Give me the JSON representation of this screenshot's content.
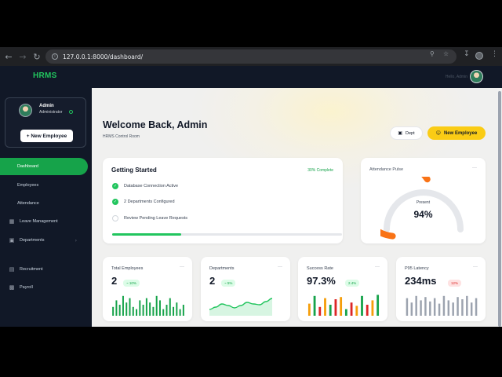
{
  "browser": {
    "url": "127.0.0.1:8000/dashboard/"
  },
  "header": {
    "brand": "HRMS",
    "user_text": "Hello, Admin"
  },
  "sidebar": {
    "profile": {
      "name": "Admin",
      "role": "Administrator"
    },
    "new_employee_label": "+ New Employee",
    "items": [
      {
        "label": "Dashboard",
        "icon": "dashboard-icon",
        "active": true
      },
      {
        "label": "Employees",
        "icon": "",
        "active": false
      },
      {
        "label": "Attendance",
        "icon": "",
        "active": false
      },
      {
        "label": "Leave Management",
        "icon": "calendar-icon",
        "active": false
      },
      {
        "label": "Departments",
        "icon": "building-icon",
        "active": false
      },
      {
        "label": "Recruitment",
        "icon": "briefcase-icon",
        "active": false
      },
      {
        "label": "Payroll",
        "icon": "money-icon",
        "active": false
      }
    ]
  },
  "main": {
    "welcome": "Welcome Back, Admin",
    "subtitle": "HRMS Control Room",
    "dept_button": "Dept",
    "new_employee_button": "New Employee",
    "getting_started": {
      "title": "Getting Started",
      "complete": "30% Complete",
      "progress": 0.3,
      "items": [
        {
          "label": "Database Connection Active",
          "done": true
        },
        {
          "label": "2 Departments Configured",
          "done": true
        },
        {
          "label": "Review Pending Leave Requests",
          "done": false
        }
      ]
    },
    "attendance": {
      "title": "Attendance Pulse",
      "label": "Present",
      "value": "94%",
      "fraction": 0.94,
      "color": "#f97316"
    },
    "stats": [
      {
        "title": "Total Employees",
        "value": "2",
        "badge": "~ 10%",
        "badge_bg": "#dcfce7",
        "badge_color": "#16a34a",
        "chart": "bars",
        "colors": [
          "#16a34a"
        ],
        "bars": [
          0.4,
          0.7,
          0.5,
          0.9,
          0.6,
          0.8,
          0.4,
          0.3,
          0.7,
          0.5,
          0.8,
          0.6,
          0.4,
          0.9,
          0.7,
          0.3,
          0.5,
          0.8,
          0.4,
          0.6,
          0.3,
          0.5
        ]
      },
      {
        "title": "Departments",
        "value": "2",
        "badge": "~ 5%",
        "badge_bg": "#dcfce7",
        "badge_color": "#16a34a",
        "chart": "area",
        "colors": [
          "#22c55e"
        ],
        "points": [
          0.2,
          0.35,
          0.55,
          0.45,
          0.3,
          0.45,
          0.65,
          0.55,
          0.5,
          0.7,
          0.9
        ]
      },
      {
        "title": "Success Rate",
        "value": "97.3%",
        "badge": "2.4%",
        "badge_bg": "#dcfce7",
        "badge_color": "#16a34a",
        "chart": "bars",
        "colors": [
          "#f59e0b",
          "#16a34a",
          "#dc2626"
        ],
        "bars": [
          0.55,
          0.9,
          0.4,
          0.8,
          0.5,
          0.75,
          0.85,
          0.3,
          0.6,
          0.45,
          0.9,
          0.5,
          0.7,
          0.95
        ]
      },
      {
        "title": "P95 Latency",
        "value": "234ms",
        "badge": "12%",
        "badge_bg": "#fee2e2",
        "badge_color": "#dc2626",
        "chart": "bars",
        "colors": [
          "#9ca3af"
        ],
        "bars": [
          0.8,
          0.6,
          0.9,
          0.7,
          0.85,
          0.65,
          0.8,
          0.55,
          0.9,
          0.7,
          0.6,
          0.85,
          0.75,
          0.9,
          0.6,
          0.8
        ]
      }
    ]
  }
}
